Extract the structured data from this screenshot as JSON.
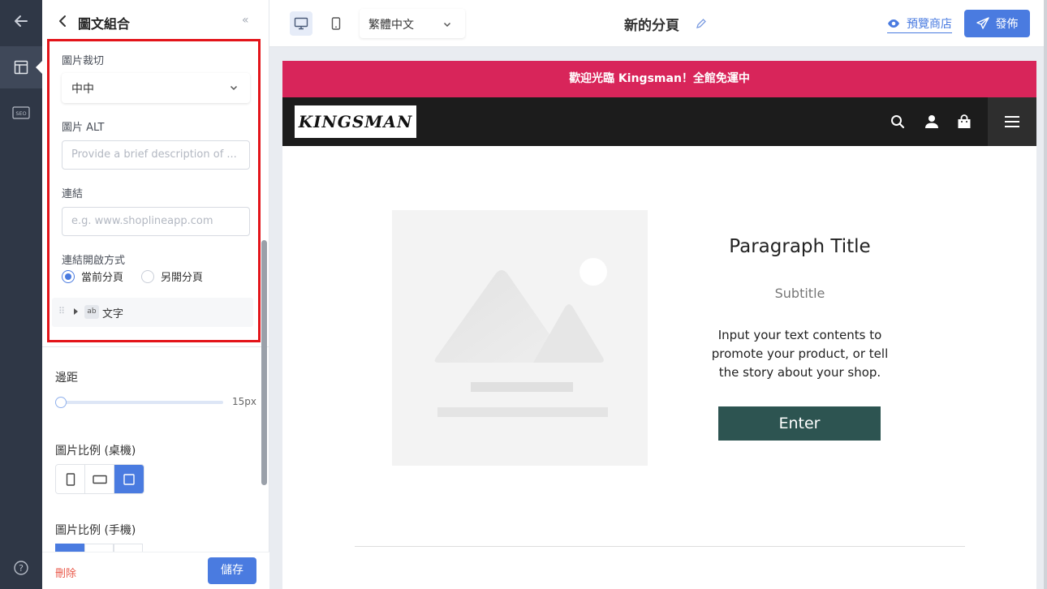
{
  "rail": {
    "items": [
      {
        "name": "back-arrow-icon"
      },
      {
        "name": "layout-icon"
      },
      {
        "name": "seo-icon",
        "label": "SEO"
      },
      {
        "name": "help-icon",
        "label": "?"
      }
    ]
  },
  "panel": {
    "title": "圖文組合",
    "crop_label": "圖片裁切",
    "crop_value": "中中",
    "alt_label": "圖片 ALT",
    "alt_placeholder": "Provide a brief description of ...",
    "link_label": "連結",
    "link_placeholder": "e.g. www.shoplineapp.com",
    "open_label": "連結開啟方式",
    "open_options": [
      {
        "label": "當前分頁",
        "selected": true
      },
      {
        "label": "另開分頁",
        "selected": false
      }
    ],
    "text_block_tag": "ab",
    "text_block_label": "文字",
    "padding_label": "邊距",
    "padding_value": "15px",
    "ratio_desktop_label": "圖片比例 (桌機)",
    "ratio_mobile_label": "圖片比例 (手機)",
    "delete_label": "刪除",
    "save_label": "儲存"
  },
  "topbar": {
    "language": "繁體中文",
    "page_title": "新的分頁",
    "preview_label": "預覽商店",
    "publish_label": "發佈",
    "accent_color": "#4a7be0"
  },
  "preview": {
    "announcement": "歡迎光臨 Kingsman！全館免運中",
    "announcement_color": "#d8255a",
    "logo_text": "KINGSMAN",
    "paragraph_title": "Paragraph Title",
    "subtitle": "Subtitle",
    "body": "Input your text contents to promote your product, or tell the story about your shop.",
    "button_label": "Enter",
    "button_color": "#2d5451"
  }
}
